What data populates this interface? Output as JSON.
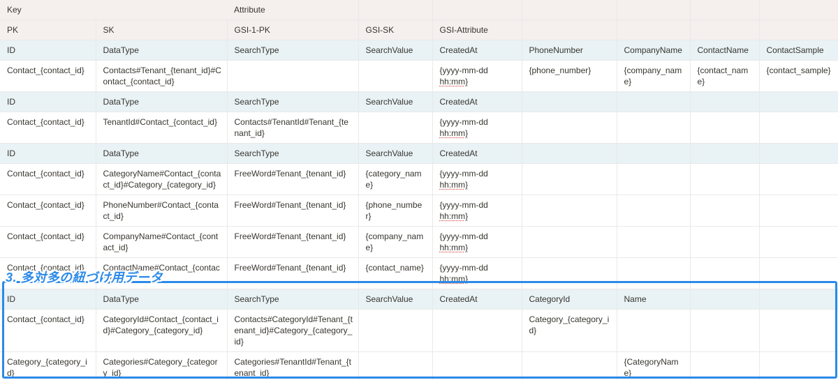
{
  "columns_count": 9,
  "header": {
    "key_label": "Key",
    "attribute_label": "Attribute"
  },
  "subheader": [
    "PK",
    "SK",
    "GSI-1-PK",
    "GSI-SK",
    "GSI-Attribute",
    "",
    "",
    "",
    ""
  ],
  "sections": [
    {
      "columns": [
        "ID",
        "DataType",
        "SearchType",
        "SearchValue",
        "CreatedAt",
        "PhoneNumber",
        "CompanyName",
        "ContactName",
        "ContactSample"
      ],
      "rows": [
        [
          "Contact_{contact_id}",
          "Contacts#Tenant_{tenant_id}#Contact_{contact_id}",
          "",
          "",
          "{yyyy-mm-dd hh:mm}",
          "{phone_number}",
          "{company_name}",
          "{contact_name}",
          "{contact_sample}"
        ]
      ]
    },
    {
      "columns": [
        "ID",
        "DataType",
        "SearchType",
        "SearchValue",
        "CreatedAt",
        "",
        "",
        "",
        ""
      ],
      "rows": [
        [
          "Contact_{contact_id}",
          "TenantId#Contact_{contact_id}",
          "Contacts#TenantId#Tenant_{tenant_id}",
          "",
          "{yyyy-mm-dd hh:mm}",
          "",
          "",
          "",
          ""
        ]
      ]
    },
    {
      "columns": [
        "ID",
        "DataType",
        "SearchType",
        "SearchValue",
        "CreatedAt",
        "",
        "",
        "",
        ""
      ],
      "rows": [
        [
          "Contact_{contact_id}",
          "CategoryName#Contact_{contact_id}#Category_{category_id}",
          "FreeWord#Tenant_{tenant_id}",
          "{category_name}",
          "{yyyy-mm-dd hh:mm}",
          "",
          "",
          "",
          ""
        ],
        [
          "Contact_{contact_id}",
          "PhoneNumber#Contact_{contact_id}",
          "FreeWord#Tenant_{tenant_id}",
          "{phone_number}",
          "{yyyy-mm-dd hh:mm}",
          "",
          "",
          "",
          ""
        ],
        [
          "Contact_{contact_id}",
          "CompanyName#Contact_{contact_id}",
          "FreeWord#Tenant_{tenant_id}",
          "{company_name}",
          "{yyyy-mm-dd hh:mm}",
          "",
          "",
          "",
          ""
        ],
        [
          "Contact_{contact_id}",
          "ContactName#Contact_{contact_id}",
          "FreeWord#Tenant_{tenant_id}",
          "{contact_name}",
          "{yyyy-mm-dd hh:mm}",
          "",
          "",
          "",
          ""
        ]
      ]
    },
    {
      "columns": [
        "ID",
        "DataType",
        "SearchType",
        "SearchValue",
        "CreatedAt",
        "CategoryId",
        "Name",
        "",
        ""
      ],
      "rows": [
        [
          "Contact_{contact_id}",
          "CategoryId#Contact_{contact_id}#Category_{category_id}",
          "Contacts#CategoryId#Tenant_{tenant_id}#Category_{category_id}",
          "",
          "",
          "Category_{category_id}",
          "",
          "",
          ""
        ],
        [
          "Category_{category_id}",
          "Categories#Category_{category_id}",
          "Categories#TenantId#Tenant_{tenant_id}",
          "",
          "",
          "",
          "{CategoryName}",
          "",
          ""
        ]
      ]
    }
  ],
  "annotation": {
    "text": "3. 多対多の紐づけ用データ",
    "color": "#2b8ae8"
  }
}
